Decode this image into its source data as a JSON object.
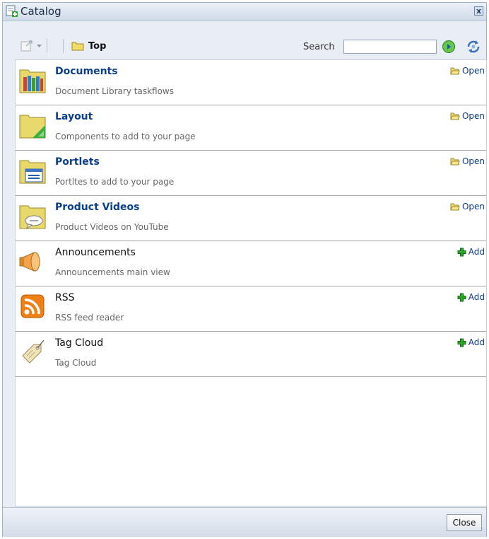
{
  "dialog": {
    "title": "Catalog",
    "close_glyph": "x"
  },
  "toolbar": {
    "folder_label": "Top",
    "search_label": "Search",
    "search_value": "",
    "search_placeholder": ""
  },
  "items": [
    {
      "title": "Documents",
      "desc": "Document Library taskflows",
      "action": "Open",
      "icon": "document-library-folder-icon"
    },
    {
      "title": "Layout",
      "desc": "Components to add to your page",
      "action": "Open",
      "icon": "layout-folder-icon"
    },
    {
      "title": "Portlets",
      "desc": "Portltes to add to your page",
      "action": "Open",
      "icon": "portlets-folder-icon"
    },
    {
      "title": "Product Videos",
      "desc": "Product Videos on YouTube",
      "action": "Open",
      "icon": "videos-folder-icon"
    },
    {
      "title": "Announcements",
      "desc": "Announcements main view",
      "action": "Add",
      "icon": "megaphone-icon"
    },
    {
      "title": "RSS",
      "desc": "RSS feed reader",
      "action": "Add",
      "icon": "rss-icon"
    },
    {
      "title": "Tag Cloud",
      "desc": "Tag Cloud",
      "action": "Add",
      "icon": "tag-icon"
    }
  ],
  "footer": {
    "close_label": "Close"
  },
  "colors": {
    "link": "#0a3e8e",
    "folder": "#e8d86a",
    "add_plus": "#2aa52a",
    "rss": "#f07f14"
  }
}
